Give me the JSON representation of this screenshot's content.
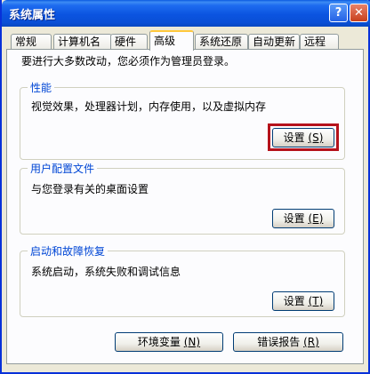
{
  "window": {
    "title": "系统属性",
    "help_label": "?",
    "close_label": "✕"
  },
  "tabs": [
    {
      "label": "常规"
    },
    {
      "label": "计算机名"
    },
    {
      "label": "硬件"
    },
    {
      "label": "高级"
    },
    {
      "label": "系统还原"
    },
    {
      "label": "自动更新"
    },
    {
      "label": "远程"
    }
  ],
  "intro_text": "要进行大多数改动，您必须作为管理员登录。",
  "performance": {
    "legend": "性能",
    "description": "视觉效果，处理器计划，内存使用，以及虚拟内存",
    "button_label": "设置",
    "button_key": "(S)"
  },
  "user_profiles": {
    "legend": "用户配置文件",
    "description": "与您登录有关的桌面设置",
    "button_label": "设置",
    "button_key": "(E)"
  },
  "startup_recovery": {
    "legend": "启动和故障恢复",
    "description": "系统启动，系统失败和调试信息",
    "button_label": "设置",
    "button_key": "(T)"
  },
  "bottom_buttons": {
    "env_label": "环境变量",
    "env_key": "(N)",
    "error_label": "错误报告",
    "error_key": "(R)"
  },
  "colors": {
    "title_bar": "#0b54e0",
    "group_legend": "#0046d5",
    "highlight": "#b5121b"
  }
}
